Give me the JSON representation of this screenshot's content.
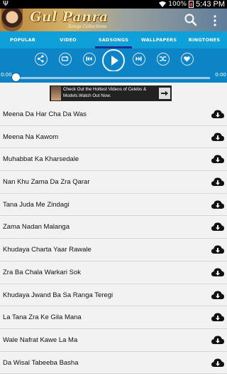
{
  "status": {
    "battery": "100%",
    "time": "5:43 PM"
  },
  "header": {
    "title": "Gul Panra",
    "subtitle": "Songs Collections"
  },
  "tabs": [
    {
      "label": "POPULAR"
    },
    {
      "label": "VIDEO"
    },
    {
      "label": "SADSONGS",
      "active": true
    },
    {
      "label": "WALLPAPERS"
    },
    {
      "label": "RINGTONES"
    }
  ],
  "player": {
    "elapsed": "0:00",
    "duration": "0:00",
    "progress": 0,
    "controls": [
      "share-icon",
      "repeat-icon",
      "previous-icon",
      "play-icon",
      "next-icon",
      "shuffle-icon",
      "favorite-icon"
    ]
  },
  "ad": {
    "text": "Check Out the Hottest Videos of Celebs & Models.Watch Out Now."
  },
  "songs": [
    "Meena Da Har Cha Da Was",
    "Meena Na Kawom",
    "Muhabbat Ka Kharsedale",
    "Nan Khu Zama Da Zra Qarar",
    "Tana Juda Me Zindagi",
    "Zama Nadan Malanga",
    "Khudaya Charta Yaar Rawale",
    "Zra Ba Chala Warkari Sok",
    "Khudaya Jwand Ba Sa Ranga Teregi",
    "La Tana Zra Ke Gila Mana",
    "Wale Nafrat Kawe La Ma",
    "Da Wisal Tabeeba Basha"
  ],
  "colors": {
    "tab_bar": "#0f9fd9",
    "player": "#0c84c6",
    "tab_indicator": "#1d2f8f"
  }
}
